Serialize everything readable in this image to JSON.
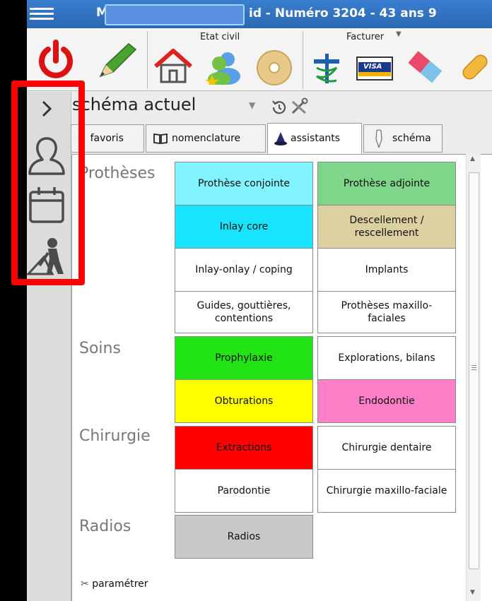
{
  "titlebar": {
    "left_letter": "M",
    "title": "id  -  Numéro 3204   -   43 ans 9"
  },
  "toolbar": {
    "etat_civil_label": "Etat civil",
    "facturer_label": "Facturer",
    "visa_label": "VISA"
  },
  "schema": {
    "title": "schéma actuel"
  },
  "tabs": [
    {
      "label": "favoris"
    },
    {
      "label": "nomenclature"
    },
    {
      "label": "assistants"
    },
    {
      "label": "schéma"
    }
  ],
  "sections": {
    "protheses": "Prothèses",
    "soins": "Soins",
    "chirurgie": "Chirurgie",
    "radios": "Radios"
  },
  "cells": [
    {
      "label": "Prothèse conjointe",
      "color": "#80f3ff"
    },
    {
      "label": "Prothèse adjointe",
      "color": "#7fd68a"
    },
    {
      "label": "Inlay core",
      "color": "#19e4ff"
    },
    {
      "label": "Descellement / rescellement",
      "color": "#ddd0a0"
    },
    {
      "label": "Inlay-onlay / coping",
      "color": "#ffffff"
    },
    {
      "label": "Implants",
      "color": "#ffffff"
    },
    {
      "label": "Guides, gouttières, contentions",
      "color": "#ffffff"
    },
    {
      "label": "Prothèses maxillo-faciales",
      "color": "#ffffff"
    },
    {
      "label": "Prophylaxie",
      "color": "#22e316"
    },
    {
      "label": "Explorations, bilans",
      "color": "#ffffff"
    },
    {
      "label": "Obturations",
      "color": "#ffff00"
    },
    {
      "label": "Endodontie",
      "color": "#ff80c8"
    },
    {
      "label": "Extractions",
      "color": "#ff0000"
    },
    {
      "label": "Chirurgie dentaire",
      "color": "#ffffff"
    },
    {
      "label": "Parodontie",
      "color": "#ffffff"
    },
    {
      "label": "Chirurgie maxillo-faciale",
      "color": "#ffffff"
    },
    {
      "label": "Radios",
      "color": "#c8c8c8"
    }
  ],
  "footer": {
    "param_label": "paramétrer"
  },
  "accents": {
    "titlebar": "#2b66b2",
    "highlight": "#ff0000"
  }
}
